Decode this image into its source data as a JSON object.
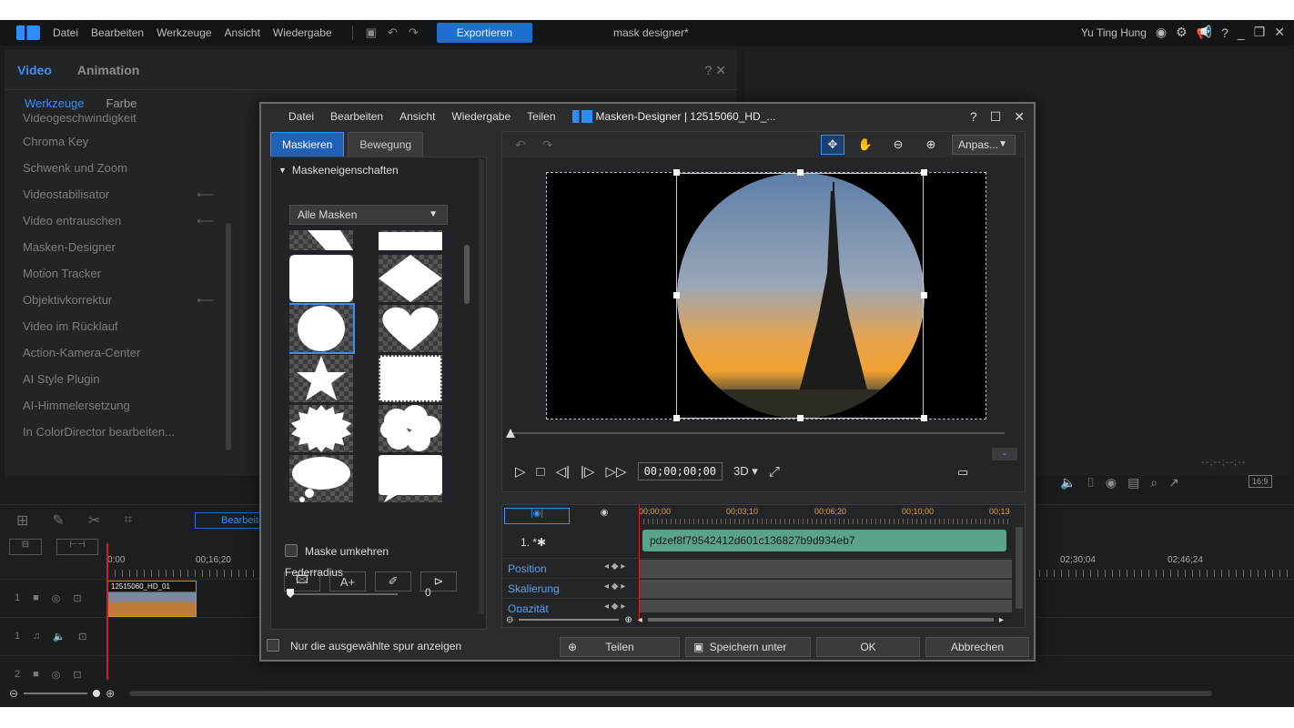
{
  "app": {
    "menu": [
      "Datei",
      "Bearbeiten",
      "Werkzeuge",
      "Ansicht",
      "Wiedergabe"
    ],
    "export_label": "Exportieren",
    "window_title": "mask designer*",
    "user": "Yu Ting Hung"
  },
  "left_panel": {
    "tabs": [
      "Video",
      "Animation"
    ],
    "subtabs": [
      "Werkzeuge",
      "Farbe"
    ],
    "tools": [
      "Videogeschwindigkeit",
      "Chroma Key",
      "Schwenk und Zoom",
      "Videostabilisator",
      "Video entrauschen",
      "Masken-Designer",
      "Motion Tracker",
      "Objektivkorrektur",
      "Video im Rücklauf",
      "Action-Kamera-Center",
      "AI Style Plugin",
      "AI-Himmelersetzung",
      "In ColorDirector bearbeiten..."
    ],
    "help": "?",
    "close": "✕"
  },
  "timeline": {
    "bearbeiten_label": "Bearbeiten",
    "timecodes": [
      "0;00",
      "00;16;20",
      "02;30;04",
      "02;46;24"
    ],
    "clip_name": "12515060_HD_01",
    "tracks": [
      "1",
      "1",
      "2"
    ]
  },
  "preview_right": {
    "ratio": "16:9",
    "timecode": "--;--;--;--"
  },
  "dialog": {
    "menu": [
      "Datei",
      "Bearbeiten",
      "Ansicht",
      "Wiedergabe",
      "Teilen"
    ],
    "title": "Masken-Designer | 12515060_HD_...",
    "tabs": [
      "Maskieren",
      "Bewegung"
    ],
    "section_title": "Maskeneigenschaften",
    "mask_filter": "Alle Masken",
    "invert_label": "Maske umkehren",
    "feather_label": "Federradius",
    "feather_value": "0",
    "only_selected_label": "Nur die ausgewählte spur anzeigen",
    "fit_label": "Anpas...",
    "timecode": "00;00;00;00",
    "mode_3d": "3D ▾",
    "kf_timecodes": [
      "00;00;00",
      "00;03;10",
      "00;06;20",
      "00;10;00",
      "00;13"
    ],
    "kf_track": "1. *✱",
    "kf_clip_id": "pdzef8f79542412d601c136827b9d934eb7",
    "kf_rows": [
      "Position",
      "Skalierung",
      "Opazität"
    ],
    "buttons": {
      "share": "Teilen",
      "save_as": "Speichern unter",
      "ok": "OK",
      "cancel": "Abbrechen"
    }
  }
}
